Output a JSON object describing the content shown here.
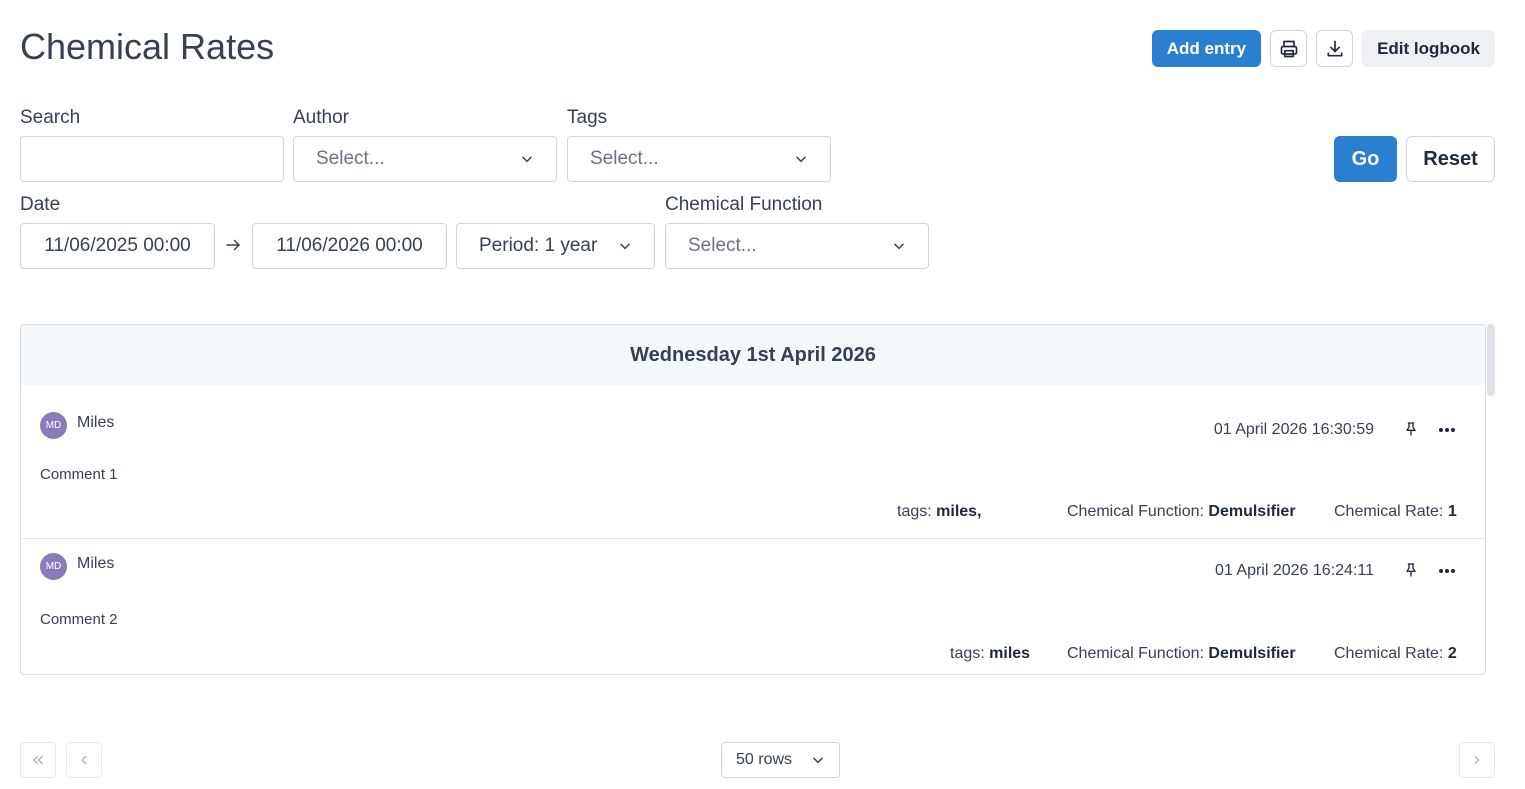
{
  "page": {
    "title": "Chemical Rates"
  },
  "header": {
    "add_entry_label": "Add entry",
    "print_icon": "printer-icon",
    "download_icon": "download-icon",
    "edit_logbook_label": "Edit logbook"
  },
  "filters": {
    "search": {
      "label": "Search",
      "value": "",
      "placeholder": ""
    },
    "author": {
      "label": "Author",
      "placeholder": "Select..."
    },
    "tags": {
      "label": "Tags",
      "placeholder": "Select..."
    },
    "date": {
      "label": "Date",
      "from": "11/06/2025 00:00",
      "to": "11/06/2026 00:00",
      "period": "Period: 1 year"
    },
    "chemical_function": {
      "label": "Chemical Function",
      "placeholder": "Select..."
    },
    "go_label": "Go",
    "reset_label": "Reset"
  },
  "log": {
    "date_heading": "Wednesday 1st April 2026",
    "entries": [
      {
        "initials": "MD",
        "author": "Miles",
        "timestamp": "01 April 2026 16:30:59",
        "comment": "Comment 1",
        "tags_label": "tags:",
        "tags_value": "miles,",
        "function_label": "Chemical Function:",
        "function_value": "Demulsifier",
        "rate_label": "Chemical Rate:",
        "rate_value": "1"
      },
      {
        "initials": "MD",
        "author": "Miles",
        "timestamp": "01 April 2026 16:24:11",
        "comment": "Comment 2",
        "tags_label": "tags:",
        "tags_value": "miles",
        "function_label": "Chemical Function:",
        "function_value": "Demulsifier",
        "rate_label": "Chemical Rate:",
        "rate_value": "2"
      }
    ]
  },
  "pagination": {
    "rows_label": "50 rows"
  },
  "colors": {
    "primary": "#2b7fd1",
    "avatar": "#8b7bb8",
    "date_header_bg": "#f5f8fb"
  }
}
